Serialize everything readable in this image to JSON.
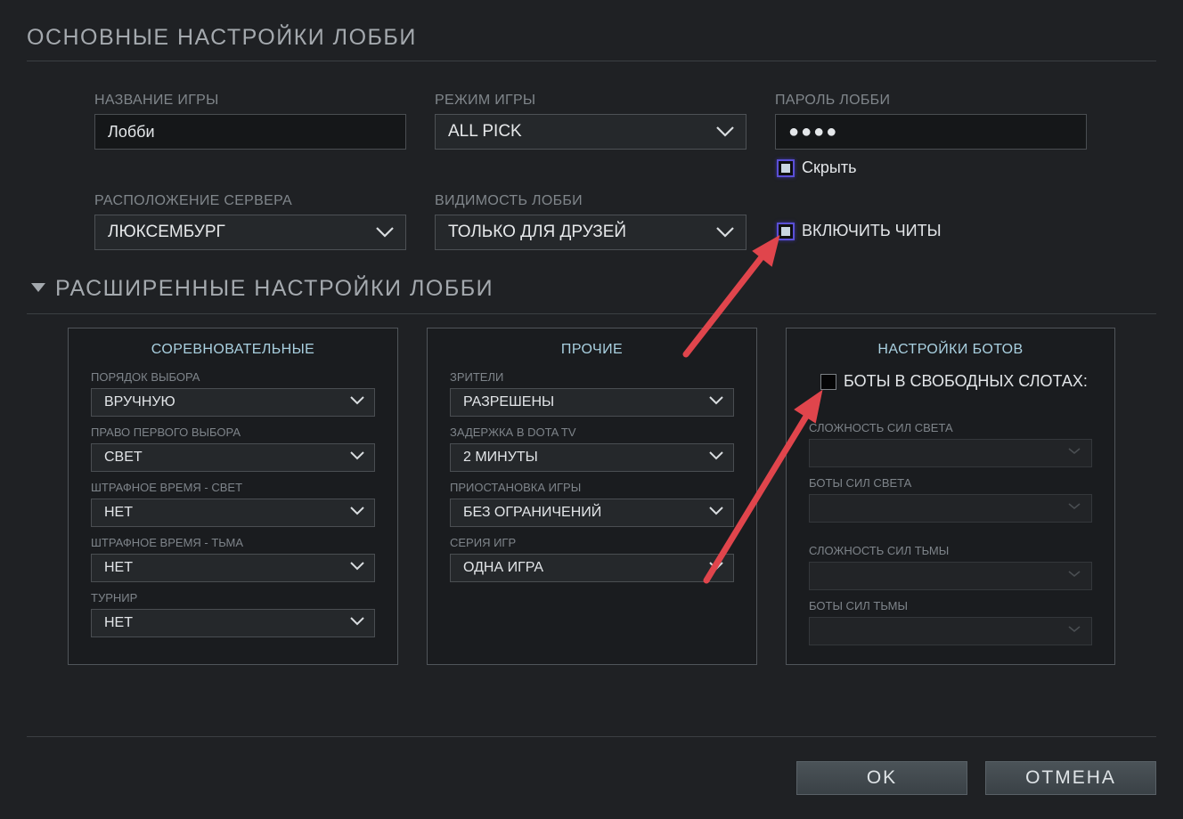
{
  "basic": {
    "title": "ОСНОВНЫЕ НАСТРОЙКИ ЛОББИ",
    "game_name": {
      "label": "НАЗВАНИЕ ИГРЫ",
      "value": "Лобби"
    },
    "game_mode": {
      "label": "РЕЖИМ ИГРЫ",
      "value": "ALL PICK"
    },
    "password": {
      "label": "ПАРОЛЬ ЛОББИ",
      "value": "●●●●"
    },
    "hide": {
      "label": "Скрыть",
      "checked": true
    },
    "server": {
      "label": "РАСПОЛОЖЕНИЕ СЕРВЕРА",
      "value": "ЛЮКСЕМБУРГ"
    },
    "visibility": {
      "label": "ВИДИМОСТЬ ЛОББИ",
      "value": "ТОЛЬКО ДЛЯ ДРУЗЕЙ"
    },
    "cheats": {
      "label": "ВКЛЮЧИТЬ ЧИТЫ",
      "checked": true
    }
  },
  "advanced": {
    "title": "РАСШИРЕННЫЕ НАСТРОЙКИ ЛОББИ",
    "competitive": {
      "title": "СОРЕВНОВАТЕЛЬНЫЕ",
      "fields": [
        {
          "label": "ПОРЯДОК ВЫБОРА",
          "value": "ВРУЧНУЮ"
        },
        {
          "label": "ПРАВО ПЕРВОГО ВЫБОРА",
          "value": "СВЕТ"
        },
        {
          "label": "ШТРАФНОЕ ВРЕМЯ - СВЕТ",
          "value": "НЕТ"
        },
        {
          "label": "ШТРАФНОЕ ВРЕМЯ - ТЬМА",
          "value": "НЕТ"
        },
        {
          "label": "ТУРНИР",
          "value": "НЕТ"
        }
      ]
    },
    "other": {
      "title": "ПРОЧИЕ",
      "fields": [
        {
          "label": "ЗРИТЕЛИ",
          "value": "РАЗРЕШЕНЫ"
        },
        {
          "label": "ЗАДЕРЖКА В DOTA TV",
          "value": "2 МИНУТЫ"
        },
        {
          "label": "ПРИОСТАНОВКА ИГРЫ",
          "value": "БЕЗ ОГРАНИЧЕНИЙ"
        },
        {
          "label": "СЕРИЯ ИГР",
          "value": "ОДНА ИГРА"
        }
      ]
    },
    "bots": {
      "title": "НАСТРОЙКИ БОТОВ",
      "fill_slots": {
        "label": "БОТЫ В СВОБОДНЫХ СЛОТАХ:",
        "checked": false
      },
      "fields": [
        {
          "label": "СЛОЖНОСТЬ СИЛ СВЕТА",
          "value": ""
        },
        {
          "label": "БОТЫ СИЛ СВЕТА",
          "value": ""
        },
        {
          "label": "СЛОЖНОСТЬ СИЛ ТЬМЫ",
          "value": ""
        },
        {
          "label": "БОТЫ СИЛ ТЬМЫ",
          "value": ""
        }
      ]
    }
  },
  "footer": {
    "ok_label": "OK",
    "cancel_label": "ОТМЕНА"
  },
  "colors": {
    "arrow": "#e0454c",
    "accent_checkbox": "#5a4fd6",
    "panel_title": "#a9d0e0"
  },
  "icons": {
    "chevron": "chevron-down-icon",
    "collapse": "triangle-down-icon",
    "annotation": "arrow-annotation-icon"
  }
}
